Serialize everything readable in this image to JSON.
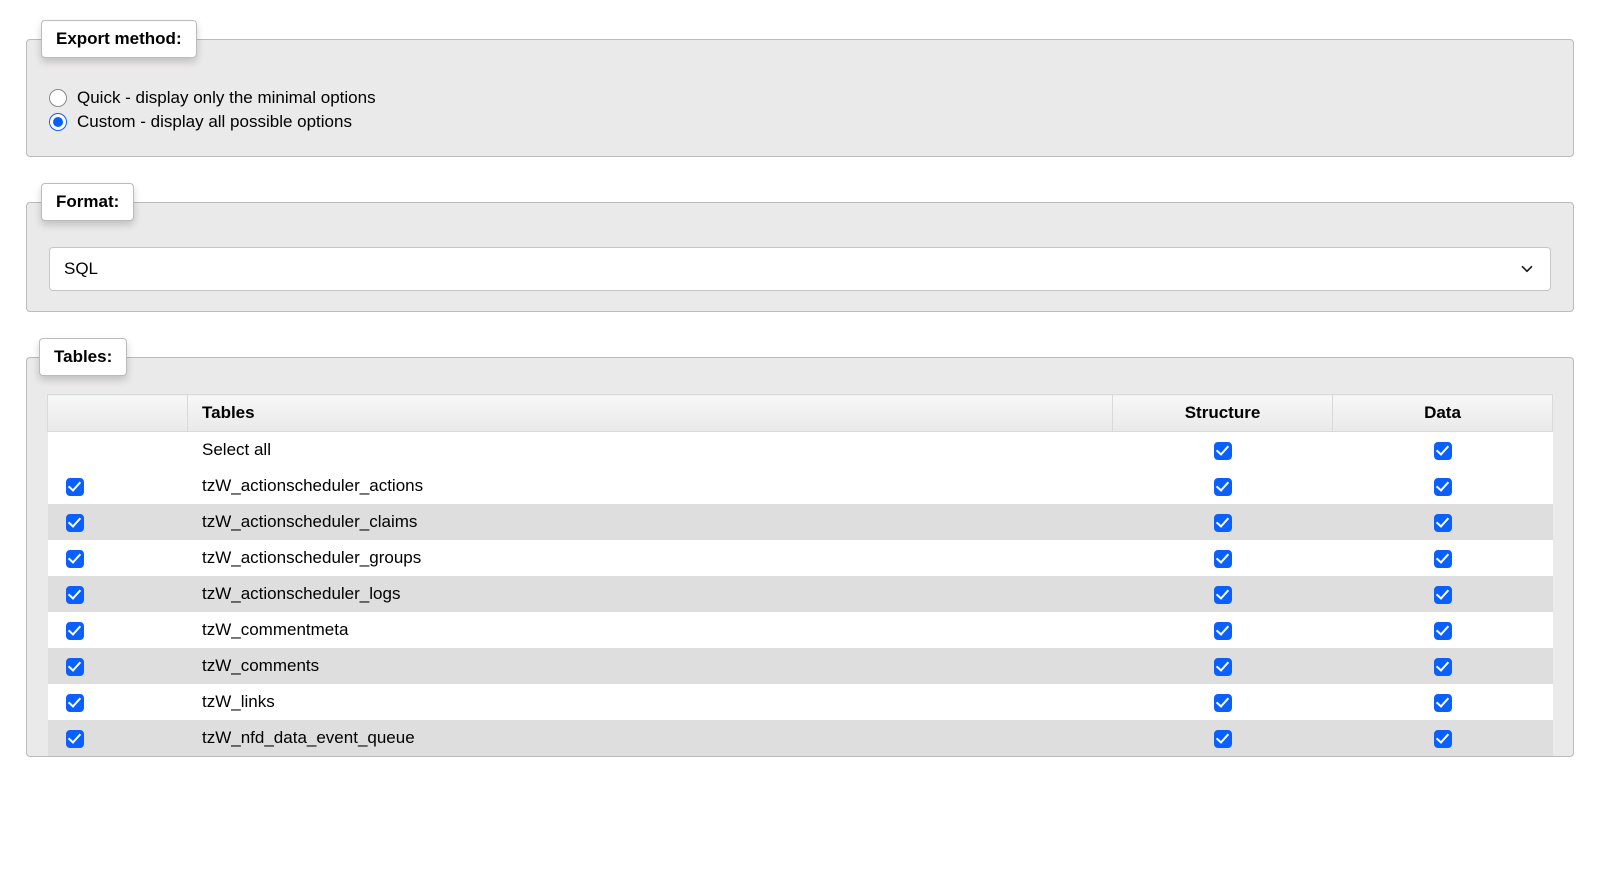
{
  "export_method": {
    "legend": "Export method:",
    "quick_label": "Quick - display only the minimal options",
    "custom_label": "Custom - display all possible options",
    "selected": "custom"
  },
  "format": {
    "legend": "Format:",
    "selected": "SQL"
  },
  "tables": {
    "legend": "Tables:",
    "headers": {
      "tables": "Tables",
      "structure": "Structure",
      "data": "Data"
    },
    "select_all_label": "Select all",
    "select_all_structure": true,
    "select_all_data": true,
    "rows": [
      {
        "name": "tzW_actionscheduler_actions",
        "selected": true,
        "structure": true,
        "data": true
      },
      {
        "name": "tzW_actionscheduler_claims",
        "selected": true,
        "structure": true,
        "data": true
      },
      {
        "name": "tzW_actionscheduler_groups",
        "selected": true,
        "structure": true,
        "data": true
      },
      {
        "name": "tzW_actionscheduler_logs",
        "selected": true,
        "structure": true,
        "data": true
      },
      {
        "name": "tzW_commentmeta",
        "selected": true,
        "structure": true,
        "data": true
      },
      {
        "name": "tzW_comments",
        "selected": true,
        "structure": true,
        "data": true
      },
      {
        "name": "tzW_links",
        "selected": true,
        "structure": true,
        "data": true
      },
      {
        "name": "tzW_nfd_data_event_queue",
        "selected": true,
        "structure": true,
        "data": true
      }
    ]
  }
}
